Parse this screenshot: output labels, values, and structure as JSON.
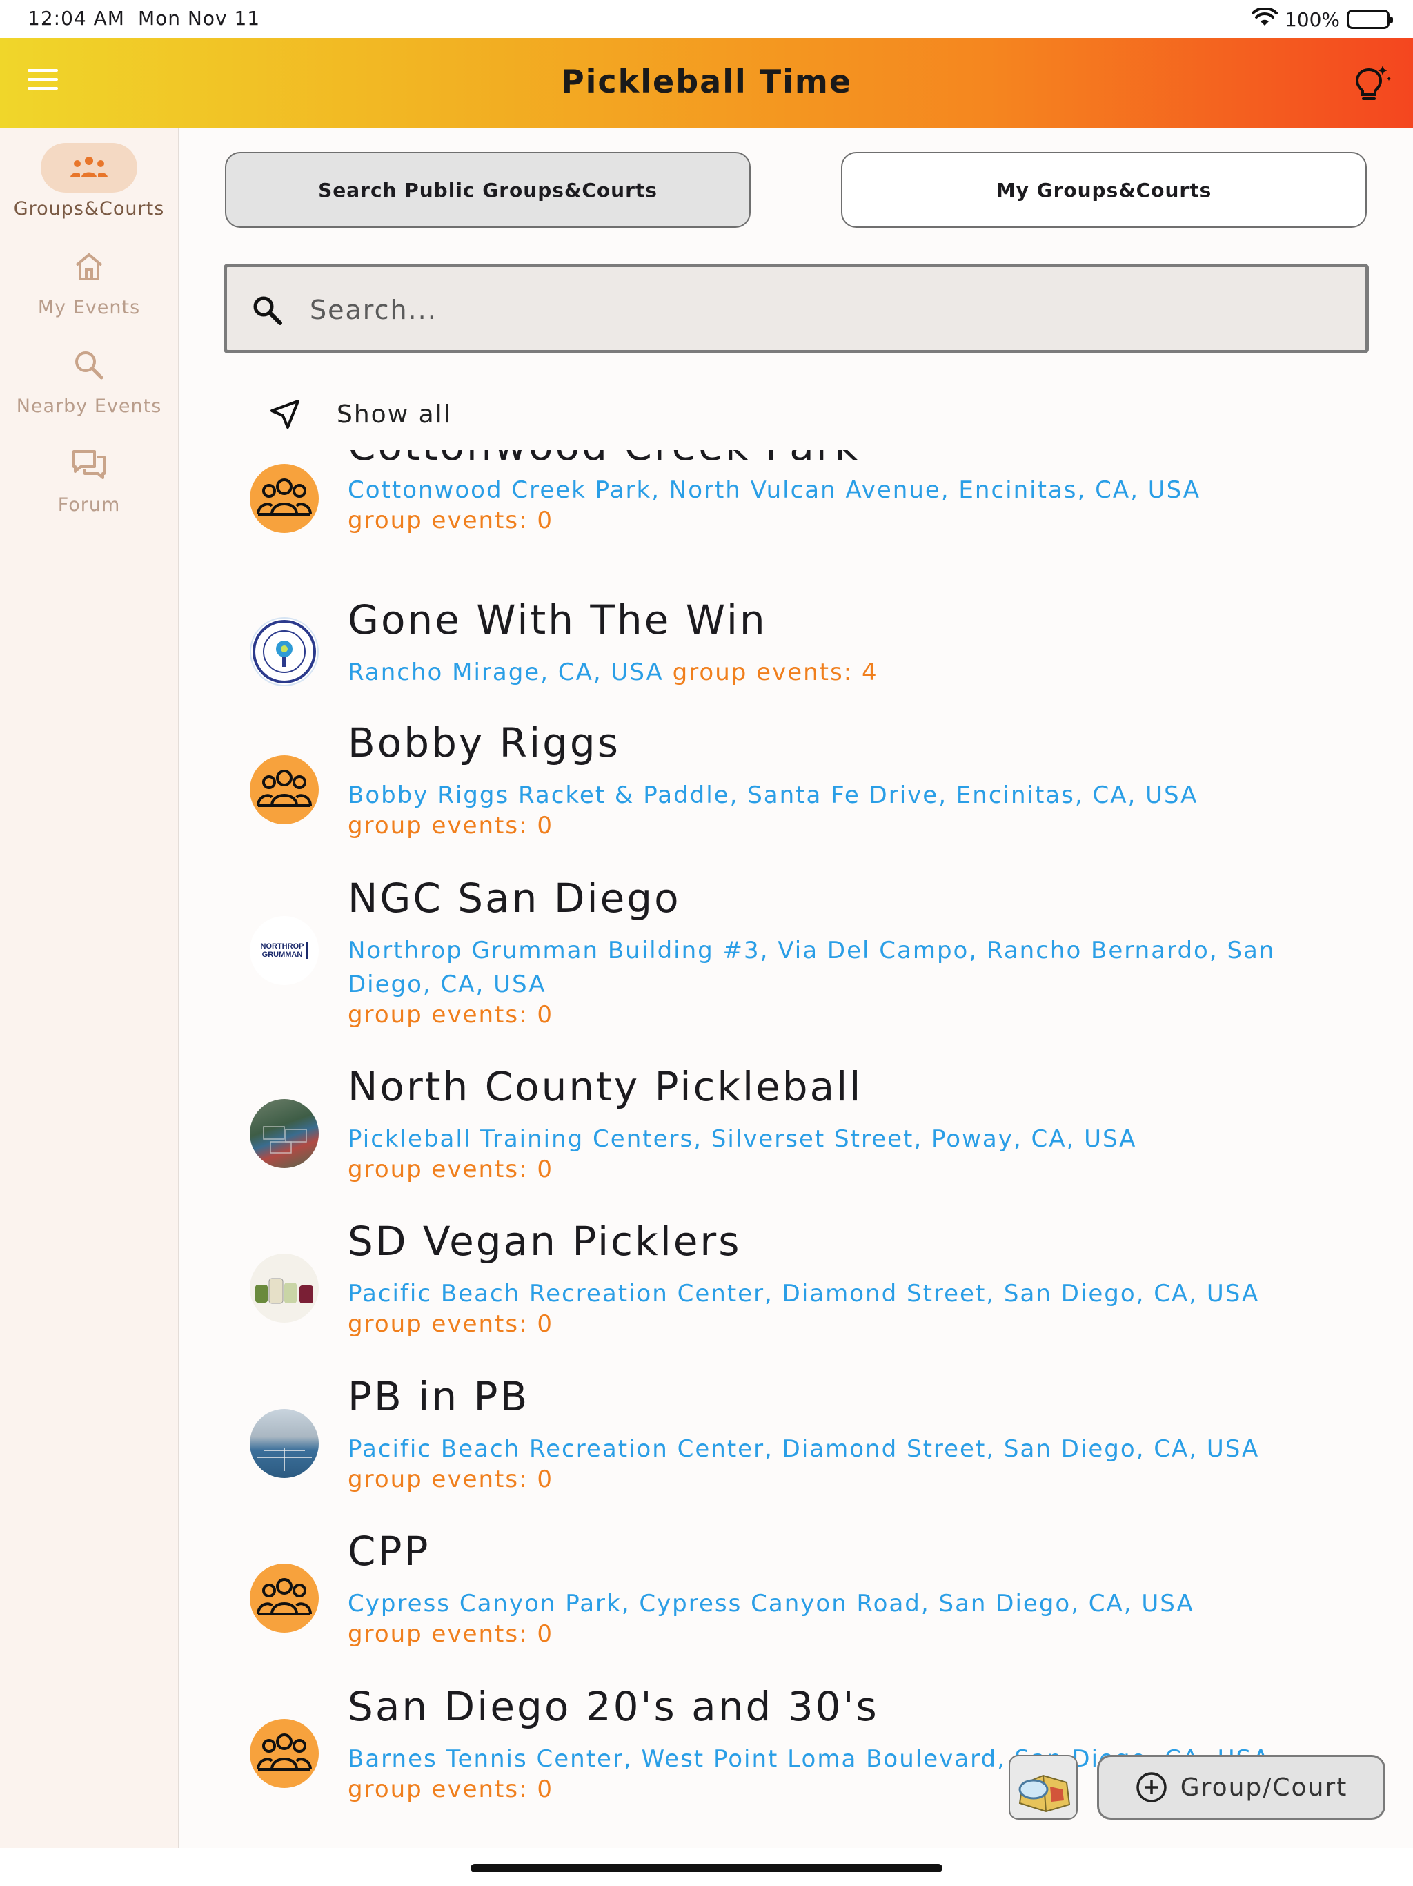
{
  "status_bar": {
    "time": "12:04 AM",
    "date": "Mon Nov 11",
    "battery": "100%"
  },
  "app_bar": {
    "title": "Pickleball Time"
  },
  "sidebar": {
    "items": [
      {
        "label": "Groups&Courts",
        "icon": "groups-icon",
        "active": true
      },
      {
        "label": "My Events",
        "icon": "home-icon",
        "active": false
      },
      {
        "label": "Nearby Events",
        "icon": "search-icon",
        "active": false
      },
      {
        "label": "Forum",
        "icon": "forum-icon",
        "active": false
      }
    ]
  },
  "tabs": {
    "search_public": "Search Public Groups&Courts",
    "my_groups": "My Groups&Courts"
  },
  "search": {
    "placeholder": "Search..."
  },
  "show_all": {
    "label": "Show all"
  },
  "groups": [
    {
      "name": "Cottonwood Creek Park",
      "address": "Cottonwood Creek Park, North Vulcan Avenue, Encinitas, CA, USA",
      "events": "group events: 0",
      "avatar": "group-placeholder"
    },
    {
      "name": "Gone With The Win",
      "address": "Rancho Mirage, CA, USA",
      "events": "group events: 4",
      "avatar": "gone-with-the-win-logo"
    },
    {
      "name": "Bobby Riggs",
      "address": "Bobby Riggs Racket & Paddle, Santa Fe Drive, Encinitas, CA, USA",
      "events": "group events: 0",
      "avatar": "group-placeholder"
    },
    {
      "name": "NGC San Diego",
      "address": "Northrop Grumman Building #3, Via Del Campo, Rancho Bernardo, San Diego, CA, USA",
      "events": "group events: 0",
      "avatar": "northrop-grumman-logo",
      "logo_text": [
        "NORTHROP",
        "GRUMMAN"
      ]
    },
    {
      "name": "North County Pickleball",
      "address": "Pickleball Training Centers, Silverset Street, Poway, CA, USA",
      "events": "group events: 0",
      "avatar": "courts-photo"
    },
    {
      "name": "SD Vegan Picklers",
      "address": "Pacific Beach Recreation Center, Diamond Street, San Diego, CA, USA",
      "events": "group events: 0",
      "avatar": "pickle-jars-photo"
    },
    {
      "name": "PB in PB",
      "address": "Pacific Beach Recreation Center, Diamond Street, San Diego, CA, USA",
      "events": "group events: 0",
      "avatar": "court-photo"
    },
    {
      "name": "CPP",
      "address": "Cypress Canyon Park, Cypress Canyon Road, San Diego, CA, USA",
      "events": "group events: 0",
      "avatar": "group-placeholder"
    },
    {
      "name": "San Diego 20's and 30's",
      "address": "Barnes Tennis Center, West Point Loma Boulevard, San Diego, CA, USA",
      "events": "group events: 0",
      "avatar": "group-placeholder"
    }
  ],
  "fab": {
    "label": "Group/Court"
  },
  "colors": {
    "accent": "#f07f1d",
    "link": "#2a9ee6",
    "group_avatar": "#f7a23d"
  }
}
